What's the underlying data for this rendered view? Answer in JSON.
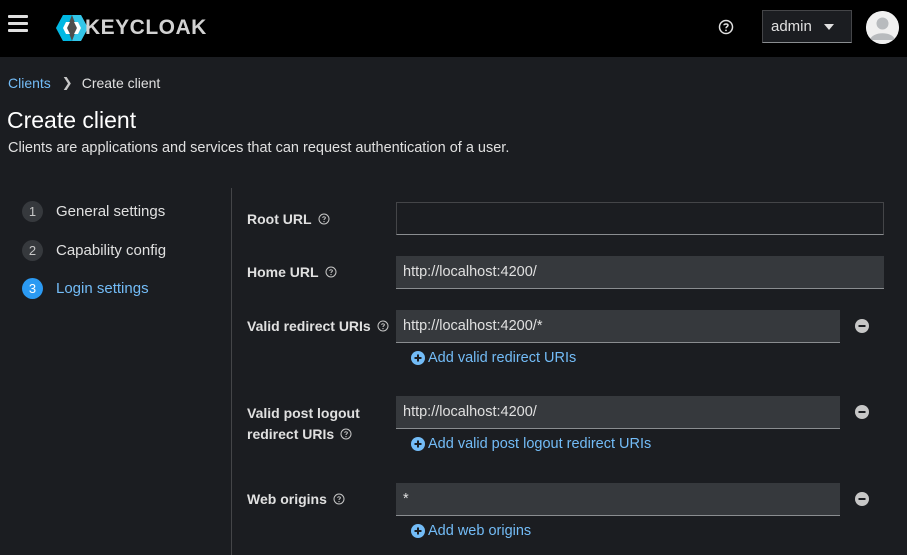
{
  "header": {
    "brand": "KEYCLOAK",
    "user": "admin"
  },
  "breadcrumb": {
    "parent": "Clients",
    "current": "Create client"
  },
  "page": {
    "title": "Create client",
    "description": "Clients are applications and services that can request authentication of a user."
  },
  "steps": [
    {
      "number": "1",
      "label": "General settings",
      "active": false
    },
    {
      "number": "2",
      "label": "Capability config",
      "active": false
    },
    {
      "number": "3",
      "label": "Login settings",
      "active": true
    }
  ],
  "form": {
    "root_url": {
      "label": "Root URL",
      "value": ""
    },
    "home_url": {
      "label": "Home URL",
      "value": "http://localhost:4200/"
    },
    "redirect_uris": {
      "label": "Valid redirect URIs",
      "value": "http://localhost:4200/*",
      "add_label": "Add valid redirect URIs"
    },
    "post_logout": {
      "label_line1": "Valid post logout",
      "label_line2": "redirect URIs",
      "value": "http://localhost:4200/",
      "add_label": "Add valid post logout redirect URIs"
    },
    "web_origins": {
      "label": "Web origins",
      "value": "*",
      "add_label": "Add web origins"
    }
  },
  "colors": {
    "accent": "#73bcf7",
    "active_step": "#2b9af3",
    "background": "#1b1d21",
    "header": "#000000",
    "input": "#36393d"
  }
}
